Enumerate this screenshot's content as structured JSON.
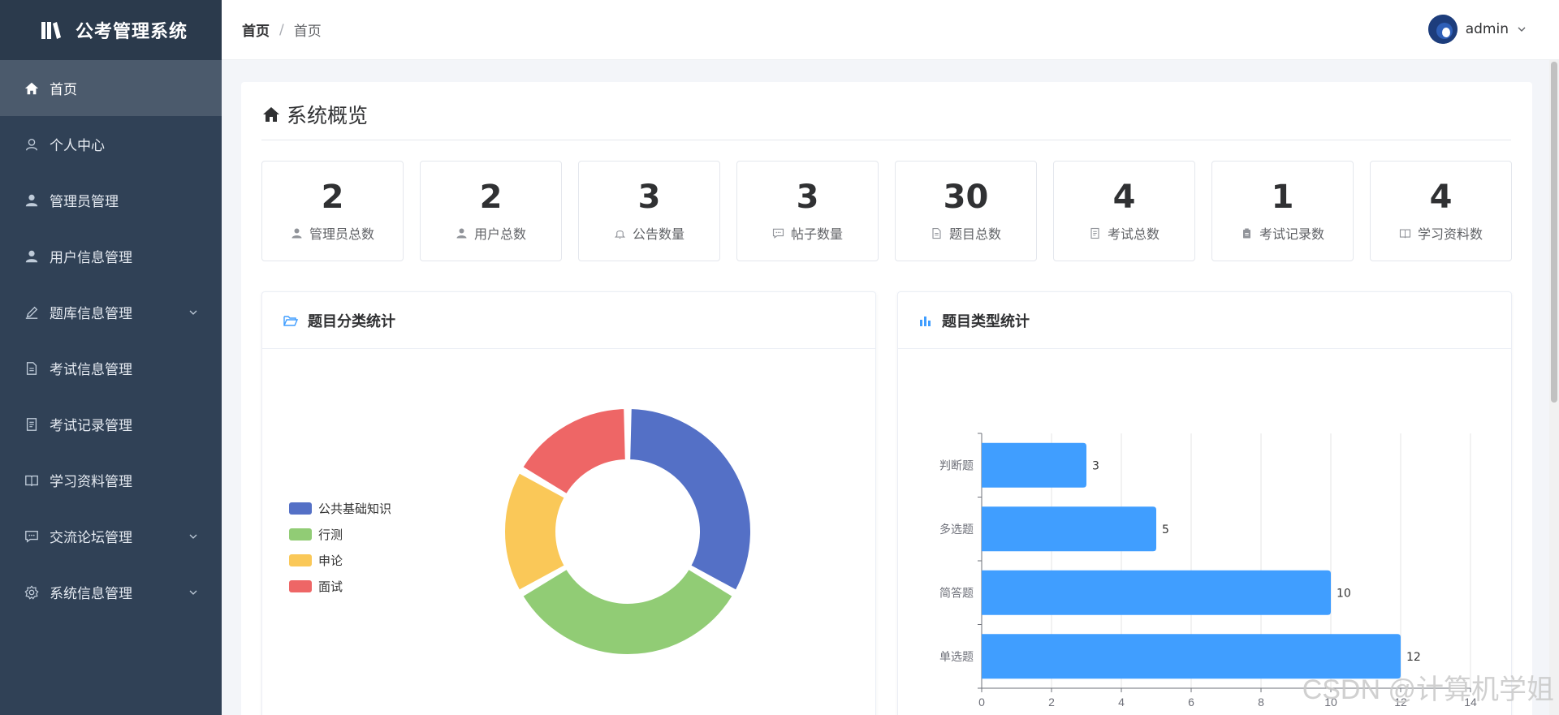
{
  "app": {
    "title": "公考管理系统"
  },
  "sidebar": {
    "items": [
      {
        "label": "首页",
        "icon": "home-icon",
        "active": true,
        "expandable": false
      },
      {
        "label": "个人中心",
        "icon": "user-outline-icon",
        "active": false,
        "expandable": false
      },
      {
        "label": "管理员管理",
        "icon": "user-icon",
        "active": false,
        "expandable": false
      },
      {
        "label": "用户信息管理",
        "icon": "user-icon",
        "active": false,
        "expandable": false
      },
      {
        "label": "题库信息管理",
        "icon": "edit-icon",
        "active": false,
        "expandable": true
      },
      {
        "label": "考试信息管理",
        "icon": "document-icon",
        "active": false,
        "expandable": false
      },
      {
        "label": "考试记录管理",
        "icon": "tickets-icon",
        "active": false,
        "expandable": false
      },
      {
        "label": "学习资料管理",
        "icon": "book-icon",
        "active": false,
        "expandable": false
      },
      {
        "label": "交流论坛管理",
        "icon": "chat-icon",
        "active": false,
        "expandable": true
      },
      {
        "label": "系统信息管理",
        "icon": "setting-icon",
        "active": false,
        "expandable": true
      }
    ]
  },
  "header": {
    "breadcrumb": {
      "home": "首页",
      "separator": "/",
      "current": "首页"
    },
    "user": {
      "name": "admin"
    }
  },
  "overview": {
    "title": "系统概览",
    "stats": [
      {
        "value": "2",
        "label": "管理员总数",
        "icon": "user-icon"
      },
      {
        "value": "2",
        "label": "用户总数",
        "icon": "user-icon"
      },
      {
        "value": "3",
        "label": "公告数量",
        "icon": "bell-icon"
      },
      {
        "value": "3",
        "label": "帖子数量",
        "icon": "chat-icon"
      },
      {
        "value": "30",
        "label": "题目总数",
        "icon": "document-icon"
      },
      {
        "value": "4",
        "label": "考试总数",
        "icon": "tickets-icon"
      },
      {
        "value": "1",
        "label": "考试记录数",
        "icon": "clipboard-icon"
      },
      {
        "value": "4",
        "label": "学习资料数",
        "icon": "book-icon"
      }
    ]
  },
  "charts": {
    "category_title": "题目分类统计",
    "type_title": "题目类型统计"
  },
  "colors": {
    "sidebar_bg": "#304156",
    "accent_blue": "#409eff",
    "pie": [
      "#5470c6",
      "#91cc75",
      "#fac858",
      "#ee6666"
    ]
  },
  "watermark": "CSDN @计算机学姐",
  "chart_data": [
    {
      "type": "pie",
      "title": "题目分类统计",
      "donut": true,
      "legend_position": "left",
      "categories": [
        "公共基础知识",
        "行测",
        "申论",
        "面试"
      ],
      "values": [
        10,
        10,
        5,
        5
      ]
    },
    {
      "type": "bar",
      "orientation": "horizontal",
      "title": "题目类型统计",
      "categories": [
        "判断题",
        "多选题",
        "简答题",
        "单选题"
      ],
      "values": [
        3,
        5,
        10,
        12
      ],
      "xlim": [
        0,
        14
      ],
      "xticks": [
        0,
        2,
        4,
        6,
        8,
        10,
        12,
        14
      ],
      "grid": "vertical",
      "data_labels": true
    }
  ]
}
